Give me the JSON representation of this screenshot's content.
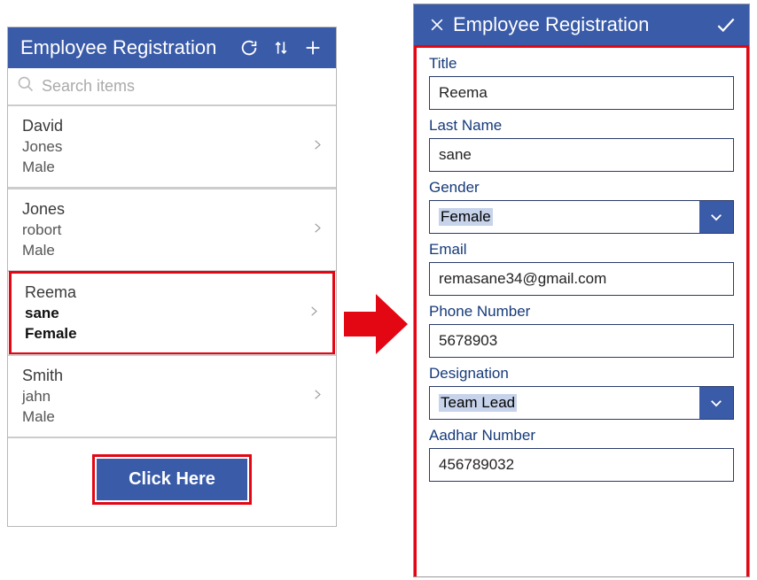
{
  "list": {
    "title": "Employee Registration",
    "search_placeholder": "Search items",
    "items": [
      {
        "first": "David",
        "last": "Jones",
        "gender": "Male",
        "highlighted": false
      },
      {
        "first": "Jones",
        "last": "robort",
        "gender": "Male",
        "highlighted": false
      },
      {
        "first": "Reema",
        "last": "sane",
        "gender": "Female",
        "highlighted": true
      },
      {
        "first": "Smith",
        "last": "jahn",
        "gender": "Male",
        "highlighted": false
      }
    ],
    "button_label": "Click Here"
  },
  "form": {
    "title": "Employee Registration",
    "fields": {
      "title": {
        "label": "Title",
        "value": "Reema"
      },
      "last_name": {
        "label": "Last Name",
        "value": "sane"
      },
      "gender": {
        "label": "Gender",
        "value": "Female"
      },
      "email": {
        "label": "Email",
        "value": "remasane34@gmail.com"
      },
      "phone": {
        "label": "Phone Number",
        "value": "5678903"
      },
      "designation": {
        "label": "Designation",
        "value": "Team Lead"
      },
      "aadhar": {
        "label": "Aadhar Number",
        "value": "456789032"
      }
    }
  }
}
